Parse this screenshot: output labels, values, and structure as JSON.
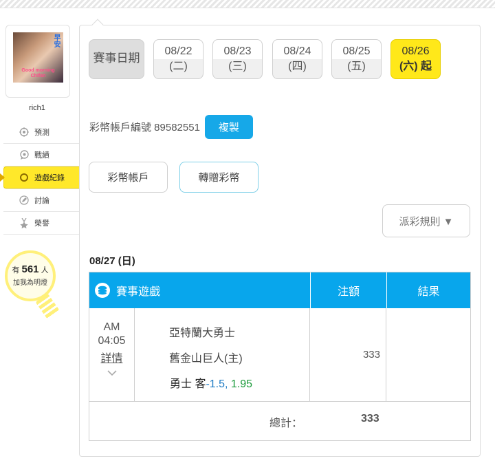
{
  "sidebar": {
    "avatar": {
      "badge": "早安",
      "caption": "Good morning\nChifan"
    },
    "username": "rich1",
    "nav": [
      {
        "label": "預測",
        "icon": "target-icon"
      },
      {
        "label": "戰績",
        "icon": "chat-icon"
      },
      {
        "label": "遊戲紀錄",
        "icon": "ring-icon",
        "active": true
      },
      {
        "label": "討論",
        "icon": "edit-icon"
      },
      {
        "label": "榮譽",
        "icon": "medal-icon"
      }
    ],
    "bulb": {
      "prefix": "有",
      "count": "561",
      "suffix": "人",
      "line2": "加我為明燈"
    }
  },
  "dates": {
    "label": "賽事日期",
    "items": [
      {
        "date": "08/22",
        "day": "(二)"
      },
      {
        "date": "08/23",
        "day": "(三)"
      },
      {
        "date": "08/24",
        "day": "(四)"
      },
      {
        "date": "08/25",
        "day": "(五)"
      },
      {
        "date": "08/26",
        "day": "(六) 起",
        "active": true
      }
    ]
  },
  "account": {
    "label": "彩幣帳戶編號 89582551",
    "copy": "複製"
  },
  "buttons": {
    "coin_account": "彩幣帳戶",
    "transfer": "轉贈彩幣",
    "rules": "派彩規則 ▼"
  },
  "section_date": "08/27 (日)",
  "table": {
    "headers": {
      "game": "賽事遊戲",
      "amount": "注額",
      "result": "結果"
    },
    "row": {
      "ampm": "AM",
      "time": "04:05",
      "detail": "詳情",
      "team_away": "亞特蘭大勇士",
      "team_home": "舊金山巨人(主)",
      "bet_label": "勇士 客",
      "handicap": "-1.5,",
      "odds": " 1.95",
      "amount": "333",
      "result": ""
    },
    "total": {
      "label": "總計：",
      "value": "333"
    }
  },
  "colors": {
    "accent_blue": "#08a6ec",
    "active_yellow": "#ffe81a",
    "odds_green": "#1a9a3a",
    "handicap_blue": "#1e7bc4"
  }
}
